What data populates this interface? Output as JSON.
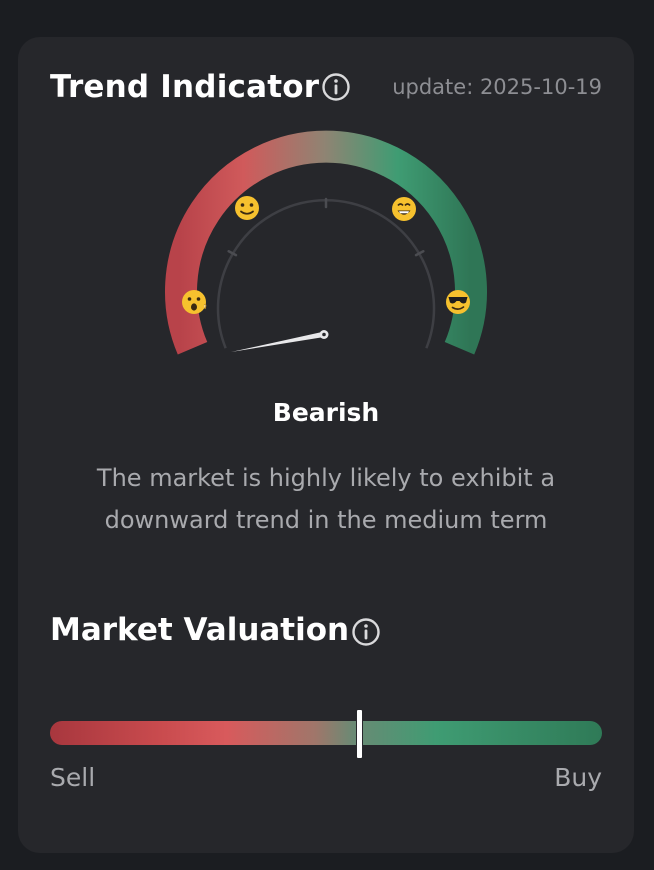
{
  "trend": {
    "title": "Trend Indicator",
    "update_text": "update: 2025-10-19",
    "state_label": "Bearish",
    "description_line1": "The market is highly likely to exhibit a",
    "description_line2": "downward trend in the medium term",
    "needle_level": 0.04,
    "emojis": [
      "scared-face-icon",
      "slight-smile-icon",
      "grin-icon",
      "sunglasses-icon"
    ],
    "colors": {
      "bearish": "#c94b4e",
      "neutral": "#8a7a6e",
      "bullish": "#3f9c73"
    }
  },
  "valuation": {
    "title": "Market Valuation",
    "left_label": "Sell",
    "right_label": "Buy",
    "marker_level": 0.56
  }
}
